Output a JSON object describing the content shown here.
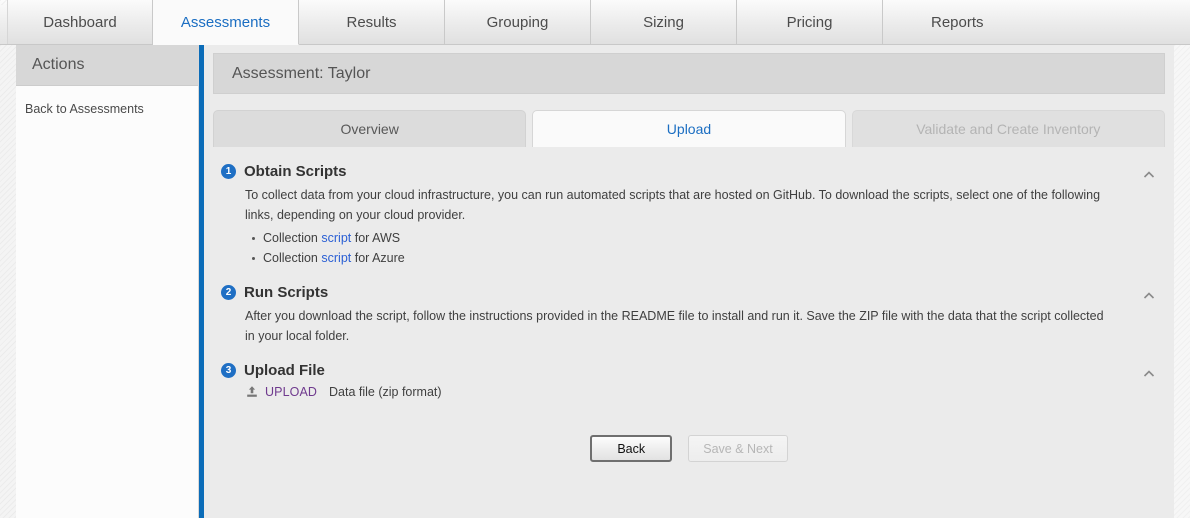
{
  "colors": {
    "accent_blue": "#1b6ec2",
    "divider_blue": "#0b6cb8",
    "badge_blue": "#1f6fc4",
    "link_blue": "#2a5fd4",
    "upload_purple": "#6f3a8e",
    "panel_gray": "#ebebeb",
    "header_gray": "#d7d7d7"
  },
  "topnav": {
    "tabs": [
      {
        "label": "Dashboard",
        "active": false
      },
      {
        "label": "Assessments",
        "active": true
      },
      {
        "label": "Results",
        "active": false
      },
      {
        "label": "Grouping",
        "active": false
      },
      {
        "label": "Sizing",
        "active": false
      },
      {
        "label": "Pricing",
        "active": false
      },
      {
        "label": "Reports",
        "active": false
      }
    ]
  },
  "sidebar": {
    "title": "Actions",
    "links": [
      {
        "label": "Back to Assessments"
      }
    ]
  },
  "main": {
    "header_title": "Assessment: Taylor",
    "subtabs": [
      {
        "label": "Overview",
        "state": "inactive"
      },
      {
        "label": "Upload",
        "state": "active"
      },
      {
        "label": "Validate and Create Inventory",
        "state": "disabled"
      }
    ],
    "steps": [
      {
        "number": "1",
        "title": "Obtain Scripts",
        "paragraph": "To collect data from your cloud infrastructure, you can run automated scripts that are hosted on GitHub. To download the scripts, select one of the following links, depending on your cloud provider.",
        "bullets": [
          {
            "prefix": "Collection ",
            "link": "script",
            "suffix": " for AWS"
          },
          {
            "prefix": "Collection ",
            "link": "script",
            "suffix": " for Azure"
          }
        ],
        "collapse_icon": "chevron-up-icon"
      },
      {
        "number": "2",
        "title": "Run Scripts",
        "paragraph": "After you download the script, follow the instructions provided in the README file to install and run it. Save the ZIP file with the data that the script collected in your local folder.",
        "collapse_icon": "chevron-up-icon"
      },
      {
        "number": "3",
        "title": "Upload File",
        "upload": {
          "icon": "upload-icon",
          "label": "UPLOAD",
          "hint": "Data file (zip format)"
        },
        "collapse_icon": "chevron-up-icon"
      }
    ],
    "footer": {
      "back_label": "Back",
      "save_next_label": "Save & Next"
    }
  }
}
